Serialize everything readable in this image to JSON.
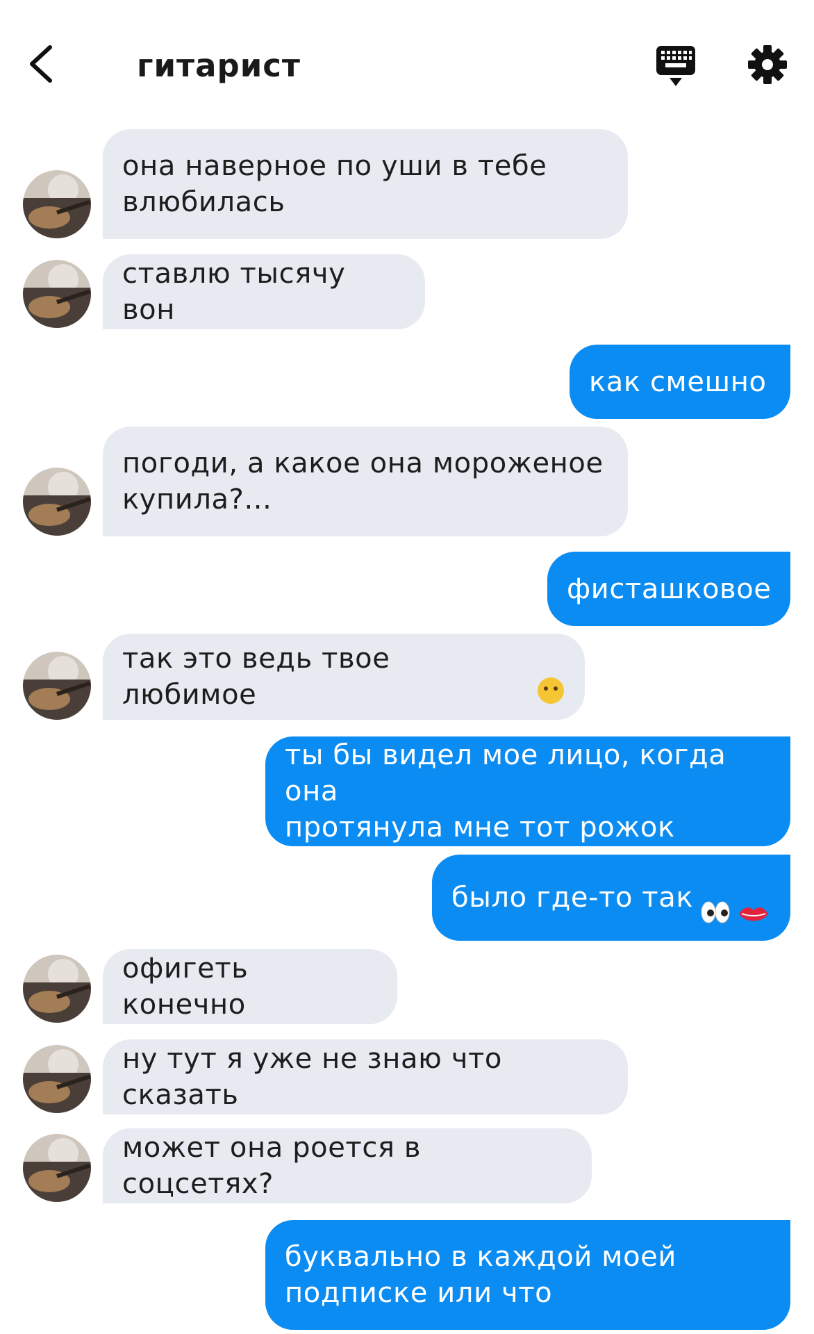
{
  "header": {
    "title": "гитарист"
  },
  "messages": [
    {
      "side": "in",
      "text": "она наверное по уши в тебе\nвлюбилась"
    },
    {
      "side": "in",
      "text": "ставлю тысячу вон"
    },
    {
      "side": "out",
      "text": "как смешно"
    },
    {
      "side": "in",
      "text": "погоди, а какое она мороженое\nкупила?..."
    },
    {
      "side": "out",
      "text": "фисташковое"
    },
    {
      "side": "in",
      "text": "так это ведь твое любимое",
      "emoji": "neutral-face-emoji"
    },
    {
      "side": "out",
      "text": "ты бы видел мое лицо, когда она\nпротянула мне тот рожок"
    },
    {
      "side": "out",
      "text": "было где-то так",
      "emoji": "eyes-lips-emoji"
    },
    {
      "side": "in",
      "text": "офигеть конечно"
    },
    {
      "side": "in",
      "text": "ну тут я уже не знаю что сказать"
    },
    {
      "side": "in",
      "text": "может она роется в соцсетях?"
    },
    {
      "side": "out",
      "text": "буквально в каждой моей\nподписке или что"
    }
  ],
  "colors": {
    "incoming_bubble": "#e8eaf1",
    "outgoing_bubble": "#0b8cf2",
    "outgoing_text": "#ffffff"
  },
  "icons": {
    "back": "chevron-left-icon",
    "keyboard": "keyboard-icon",
    "settings": "gear-icon"
  }
}
